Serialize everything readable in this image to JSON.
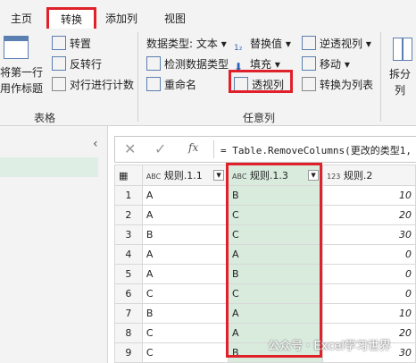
{
  "titlebar": {
    "text": ""
  },
  "tabs": {
    "home": "主页",
    "transform": "转换",
    "add_column": "添加列",
    "view": "视图"
  },
  "ribbon": {
    "table_group": {
      "first_row_label_line1": "将第一行",
      "first_row_label_line2": "用作标题",
      "transpose": "转置",
      "reverse_rows": "反转行",
      "count_rows": "对行进行计数",
      "group_label": "表格"
    },
    "any_column_group": {
      "data_type": "数据类型: 文本",
      "detect_type": "检测数据类型",
      "rename": "重命名",
      "replace_values": "替换值",
      "fill": "填充",
      "pivot": "透视列",
      "unpivot": "逆透视列",
      "move": "移动",
      "to_list": "转换为列表",
      "group_label": "任意列"
    },
    "split_group": {
      "split_line1": "拆分",
      "split_line2": "列"
    }
  },
  "formula_bar": {
    "fx": "fx",
    "formula": "= Table.RemoveColumns(更改的类型1,"
  },
  "grid": {
    "columns": [
      {
        "type": "ABC",
        "name": "规则.1.1"
      },
      {
        "type": "ABC",
        "name": "规则.1.3"
      },
      {
        "type": "123",
        "name": "规则.2"
      }
    ],
    "rows": [
      {
        "n": "1",
        "c1": "A",
        "c3": "B",
        "c2": "10"
      },
      {
        "n": "2",
        "c1": "A",
        "c3": "C",
        "c2": "20"
      },
      {
        "n": "3",
        "c1": "B",
        "c3": "C",
        "c2": "30"
      },
      {
        "n": "4",
        "c1": "A",
        "c3": "A",
        "c2": "0"
      },
      {
        "n": "5",
        "c1": "A",
        "c3": "B",
        "c2": "0"
      },
      {
        "n": "6",
        "c1": "C",
        "c3": "C",
        "c2": "0"
      },
      {
        "n": "7",
        "c1": "B",
        "c3": "A",
        "c2": "10"
      },
      {
        "n": "8",
        "c1": "C",
        "c3": "A",
        "c2": "20"
      },
      {
        "n": "9",
        "c1": "C",
        "c3": "B",
        "c2": "30"
      }
    ]
  },
  "watermark": "公众号 · Excel学习世界",
  "colors": {
    "highlight_red": "#e0202a",
    "selected_column": "#d8ebdd",
    "ribbon_bg": "#f3f3f3"
  }
}
